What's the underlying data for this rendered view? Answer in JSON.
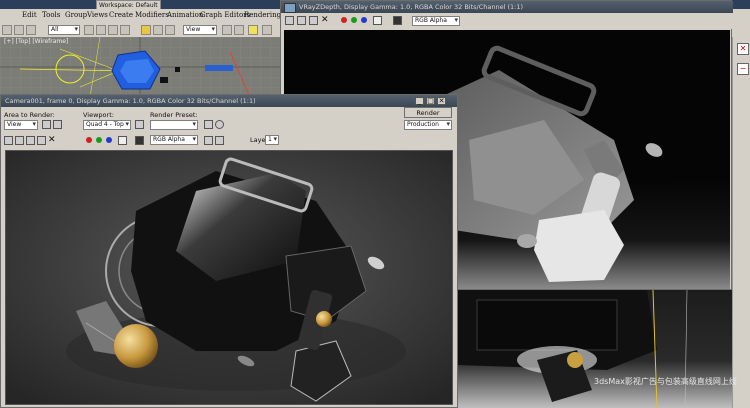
{
  "app": {
    "workspace_label": "Workspace: Default",
    "menu": [
      "Edit",
      "Tools",
      "Group",
      "Views",
      "Create",
      "Modifiers",
      "Animation",
      "Graph Editors",
      "Rendering"
    ],
    "selection_filter": "All",
    "view_dropdown": "View",
    "viewport_label": "[+] [Top] [Wireframe]"
  },
  "vray_window": {
    "title": "VRayZDepth, Display Gamma: 1.0, RGBA Color 32 Bits/Channel (1:1)",
    "channel": "RGB Alpha"
  },
  "camera_window": {
    "title": "Camera001, frame 0, Display Gamma: 1.0, RGBA Color 32 Bits/Channel (1:1)",
    "area_to_render_label": "Area to Render:",
    "area_to_render_value": "View",
    "viewport_label": "Viewport:",
    "viewport_value": "Quad 4 - Top",
    "render_preset_label": "Render Preset:",
    "render_preset_value": "",
    "render_button": "Render",
    "production_value": "Production",
    "layer_label": "Layer:",
    "layer_value": "1",
    "channel": "RGB Alpha"
  },
  "watermark": "3dsMax影视广告与包装高级直线网上线",
  "colors": {
    "title_bar": "#4a5563",
    "swatch_red": "#d12020",
    "swatch_green": "#1a9a1a",
    "swatch_blue": "#1f3ad0"
  }
}
